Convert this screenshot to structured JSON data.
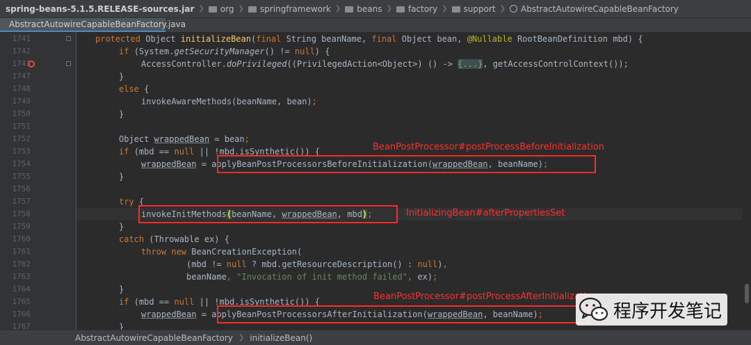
{
  "breadcrumb": {
    "items": [
      "spring-beans-5.1.5.RELEASE-sources.jar",
      "org",
      "springframework",
      "beans",
      "factory",
      "support",
      "AbstractAutowireCapableBeanFactory"
    ]
  },
  "editor": {
    "tab_label": "AbstractAutowireCapableBeanFactory.java",
    "line_numbers": [
      "1741",
      "1742",
      "1743",
      "1747",
      "1748",
      "1749",
      "1750",
      "1751",
      "1752",
      "1753",
      "1754",
      "1755",
      "1756",
      "1757",
      "1758",
      "1759",
      "1760",
      "1761",
      "1762",
      "1763",
      "1764",
      "1765",
      "1766",
      "1767"
    ]
  },
  "annotations": {
    "before_init": "BeanPostProcessor#postProcessBeforeInitialization",
    "init_methods": "InitializingBean#afterPropertiesSet",
    "after_init": "BeanPostProcessor#postProcessAfterInitialization"
  },
  "statusbar": {
    "class_name": "AbstractAutowireCapableBeanFactory",
    "method_name": "initializeBean()"
  },
  "brand": {
    "text": "程序开发笔记"
  },
  "colors": {
    "background": "#2b2b2b",
    "keyword": "#cc7832",
    "string": "#6a8759",
    "highlight_box": "#ff2a2a"
  }
}
